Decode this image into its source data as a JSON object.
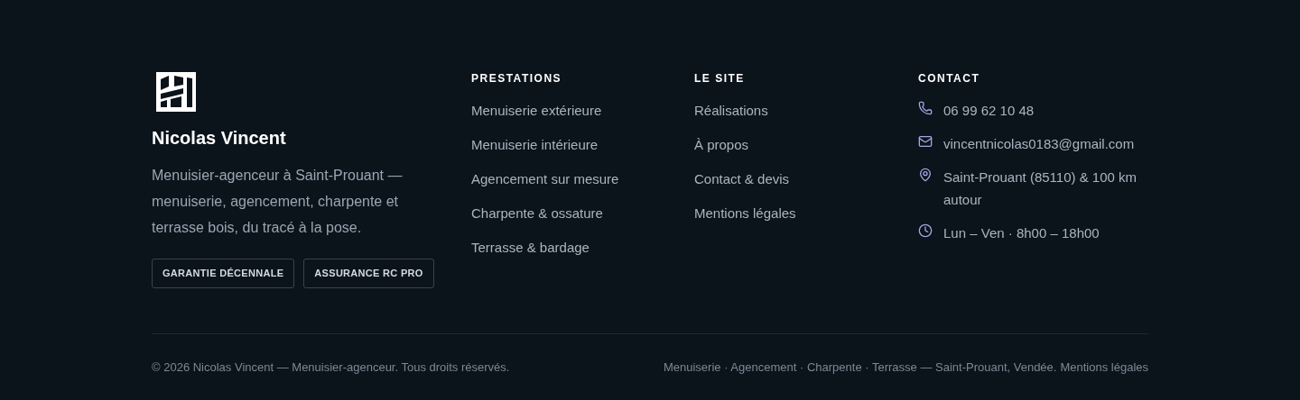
{
  "brand": {
    "name": "Nicolas Vincent",
    "description": "Menuisier-agenceur à Saint-Prouant — menuiserie, agencement, charpente et terrasse bois, du tracé à la pose.",
    "badges": [
      "GARANTIE DÉCENNALE",
      "ASSURANCE RC PRO"
    ]
  },
  "columns": [
    {
      "title": "PRESTATIONS",
      "links": [
        "Menuiserie extérieure",
        "Menuiserie intérieure",
        "Agencement sur mesure",
        "Charpente & ossature",
        "Terrasse & bardage"
      ]
    },
    {
      "title": "LE SITE",
      "links": [
        "Réalisations",
        "À propos",
        "Contact & devis",
        "Mentions légales"
      ]
    }
  ],
  "contact": {
    "title": "CONTACT",
    "items": [
      {
        "kind": "phone",
        "text": "06 99 62 10 48"
      },
      {
        "kind": "email",
        "text": "vincentnicolas0183@gmail.com"
      },
      {
        "kind": "location",
        "text": "Saint-Prouant (85110) & 100 km autour"
      },
      {
        "kind": "hours",
        "text": "Lun – Ven · 8h00 – 18h00"
      }
    ]
  },
  "bottom": {
    "copyright": "© 2026 Nicolas Vincent — Menuisier-agenceur. Tous droits réservés.",
    "tagline": "Menuiserie · Agencement · Charpente · Terrasse — Saint-Prouant, Vendée.",
    "link": "Mentions légales"
  }
}
